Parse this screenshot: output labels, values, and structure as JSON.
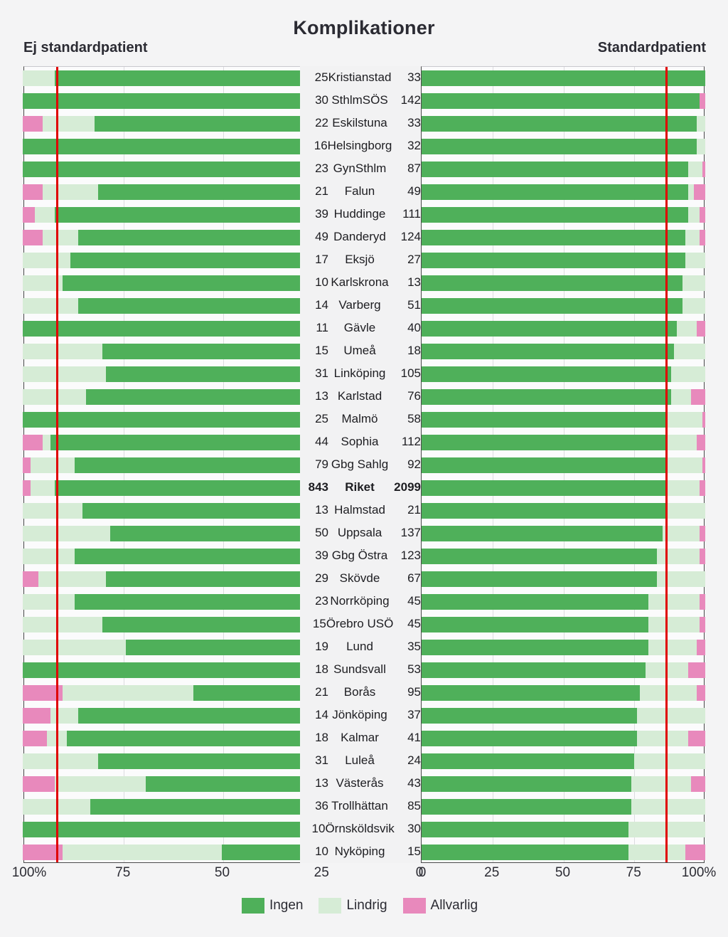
{
  "chart_data": {
    "type": "bar",
    "title": "Komplikationer",
    "subtype": "stacked-horizontal-bidirectional",
    "xlabel": "",
    "ylabel": "",
    "xlim": [
      0,
      100
    ],
    "grid": true,
    "legend_position": "bottom",
    "legend": [
      "Ingen",
      "Lindrig",
      "Allvarlig"
    ],
    "colors": {
      "ingen": "#4fb05a",
      "lindrig": "#d6ecd6",
      "allvarlig": "#e889bc",
      "reference_line": "#e00000",
      "background": "#f4f4f5"
    },
    "panels": [
      {
        "key": "left",
        "label": "Ej standardpatient",
        "reference_value": 92
      },
      {
        "key": "right",
        "label": "Standardpatient",
        "reference_value": 86
      }
    ],
    "axis_ticks_left": [
      "100%",
      "75",
      "50",
      "25",
      "0"
    ],
    "axis_ticks_right": [
      "0",
      "25",
      "50",
      "75",
      "100%"
    ],
    "tick_values_left": [
      100,
      75,
      50,
      25,
      0
    ],
    "tick_values_right": [
      0,
      25,
      50,
      75,
      100
    ],
    "series": [
      {
        "name": "Ingen",
        "key": "ingen"
      },
      {
        "name": "Lindrig",
        "key": "lindrig"
      },
      {
        "name": "Allvarlig",
        "key": "allvarlig"
      }
    ],
    "categories": [
      "Kristianstad",
      "SthlmSÖS",
      "Eskilstuna",
      "Helsingborg",
      "GynSthlm",
      "Falun",
      "Huddinge",
      "Danderyd",
      "Eksjö",
      "Karlskrona",
      "Varberg",
      "Gävle",
      "Umeå",
      "Linköping",
      "Karlstad",
      "Malmö",
      "Sophia",
      "Gbg Sahlg",
      "Riket",
      "Halmstad",
      "Uppsala",
      "Gbg Östra",
      "Skövde",
      "Norrköping",
      "Örebro USÖ",
      "Lund",
      "Sundsvall",
      "Borås",
      "Jönköping",
      "Kalmar",
      "Luleå",
      "Västerås",
      "Trollhättan",
      "Örnsköldsvik",
      "Nyköping"
    ],
    "rows": [
      {
        "name": "Kristianstad",
        "n_left": "25",
        "n_right": "33",
        "highlight": false,
        "left": {
          "ingen": 92,
          "lindrig": 8,
          "allvarlig": 0
        },
        "right": {
          "ingen": 100,
          "lindrig": 0,
          "allvarlig": 0
        }
      },
      {
        "name": "SthlmSÖS",
        "n_left": "30",
        "n_right": "142",
        "highlight": false,
        "left": {
          "ingen": 100,
          "lindrig": 0,
          "allvarlig": 0
        },
        "right": {
          "ingen": 98,
          "lindrig": 0,
          "allvarlig": 2
        }
      },
      {
        "name": "Eskilstuna",
        "n_left": "22",
        "n_right": "33",
        "highlight": false,
        "left": {
          "ingen": 82,
          "lindrig": 13,
          "allvarlig": 5
        },
        "right": {
          "ingen": 97,
          "lindrig": 3,
          "allvarlig": 0
        }
      },
      {
        "name": "Helsingborg",
        "n_left": "16",
        "n_right": "32",
        "highlight": false,
        "left": {
          "ingen": 100,
          "lindrig": 0,
          "allvarlig": 0
        },
        "right": {
          "ingen": 97,
          "lindrig": 3,
          "allvarlig": 0
        }
      },
      {
        "name": "GynSthlm",
        "n_left": "23",
        "n_right": "87",
        "highlight": false,
        "left": {
          "ingen": 100,
          "lindrig": 0,
          "allvarlig": 0
        },
        "right": {
          "ingen": 94,
          "lindrig": 5,
          "allvarlig": 1
        }
      },
      {
        "name": "Falun",
        "n_left": "21",
        "n_right": "49",
        "highlight": false,
        "left": {
          "ingen": 81,
          "lindrig": 14,
          "allvarlig": 5
        },
        "right": {
          "ingen": 94,
          "lindrig": 2,
          "allvarlig": 4
        }
      },
      {
        "name": "Huddinge",
        "n_left": "39",
        "n_right": "111",
        "highlight": false,
        "left": {
          "ingen": 92,
          "lindrig": 5,
          "allvarlig": 3
        },
        "right": {
          "ingen": 94,
          "lindrig": 4,
          "allvarlig": 2
        }
      },
      {
        "name": "Danderyd",
        "n_left": "49",
        "n_right": "124",
        "highlight": false,
        "left": {
          "ingen": 86,
          "lindrig": 9,
          "allvarlig": 5
        },
        "right": {
          "ingen": 93,
          "lindrig": 5,
          "allvarlig": 2
        }
      },
      {
        "name": "Eksjö",
        "n_left": "17",
        "n_right": "27",
        "highlight": false,
        "left": {
          "ingen": 88,
          "lindrig": 12,
          "allvarlig": 0
        },
        "right": {
          "ingen": 93,
          "lindrig": 7,
          "allvarlig": 0
        }
      },
      {
        "name": "Karlskrona",
        "n_left": "10",
        "n_right": "13",
        "highlight": false,
        "left": {
          "ingen": 90,
          "lindrig": 10,
          "allvarlig": 0
        },
        "right": {
          "ingen": 92,
          "lindrig": 8,
          "allvarlig": 0
        }
      },
      {
        "name": "Varberg",
        "n_left": "14",
        "n_right": "51",
        "highlight": false,
        "left": {
          "ingen": 86,
          "lindrig": 14,
          "allvarlig": 0
        },
        "right": {
          "ingen": 92,
          "lindrig": 8,
          "allvarlig": 0
        }
      },
      {
        "name": "Gävle",
        "n_left": "11",
        "n_right": "40",
        "highlight": false,
        "left": {
          "ingen": 100,
          "lindrig": 0,
          "allvarlig": 0
        },
        "right": {
          "ingen": 90,
          "lindrig": 7,
          "allvarlig": 3
        }
      },
      {
        "name": "Umeå",
        "n_left": "15",
        "n_right": "18",
        "highlight": false,
        "left": {
          "ingen": 80,
          "lindrig": 20,
          "allvarlig": 0
        },
        "right": {
          "ingen": 89,
          "lindrig": 11,
          "allvarlig": 0
        }
      },
      {
        "name": "Linköping",
        "n_left": "31",
        "n_right": "105",
        "highlight": false,
        "left": {
          "ingen": 79,
          "lindrig": 21,
          "allvarlig": 0
        },
        "right": {
          "ingen": 88,
          "lindrig": 12,
          "allvarlig": 0
        }
      },
      {
        "name": "Karlstad",
        "n_left": "13",
        "n_right": "76",
        "highlight": false,
        "left": {
          "ingen": 84,
          "lindrig": 16,
          "allvarlig": 0
        },
        "right": {
          "ingen": 88,
          "lindrig": 7,
          "allvarlig": 5
        }
      },
      {
        "name": "Malmö",
        "n_left": "25",
        "n_right": "58",
        "highlight": false,
        "left": {
          "ingen": 100,
          "lindrig": 0,
          "allvarlig": 0
        },
        "right": {
          "ingen": 86,
          "lindrig": 13,
          "allvarlig": 1
        }
      },
      {
        "name": "Sophia",
        "n_left": "44",
        "n_right": "112",
        "highlight": false,
        "left": {
          "ingen": 93,
          "lindrig": 2,
          "allvarlig": 5
        },
        "right": {
          "ingen": 86,
          "lindrig": 11,
          "allvarlig": 3
        }
      },
      {
        "name": "Gbg Sahlg",
        "n_left": "79",
        "n_right": "92",
        "highlight": false,
        "left": {
          "ingen": 87,
          "lindrig": 11,
          "allvarlig": 2
        },
        "right": {
          "ingen": 86,
          "lindrig": 13,
          "allvarlig": 1
        }
      },
      {
        "name": "Riket",
        "n_left": "843",
        "n_right": "2099",
        "highlight": true,
        "left": {
          "ingen": 92,
          "lindrig": 6,
          "allvarlig": 2
        },
        "right": {
          "ingen": 86,
          "lindrig": 12,
          "allvarlig": 2
        }
      },
      {
        "name": "Halmstad",
        "n_left": "13",
        "n_right": "21",
        "highlight": false,
        "left": {
          "ingen": 85,
          "lindrig": 15,
          "allvarlig": 0
        },
        "right": {
          "ingen": 86,
          "lindrig": 14,
          "allvarlig": 0
        }
      },
      {
        "name": "Uppsala",
        "n_left": "50",
        "n_right": "137",
        "highlight": false,
        "left": {
          "ingen": 78,
          "lindrig": 22,
          "allvarlig": 0
        },
        "right": {
          "ingen": 85,
          "lindrig": 13,
          "allvarlig": 2
        }
      },
      {
        "name": "Gbg Östra",
        "n_left": "39",
        "n_right": "123",
        "highlight": false,
        "left": {
          "ingen": 87,
          "lindrig": 13,
          "allvarlig": 0
        },
        "right": {
          "ingen": 83,
          "lindrig": 15,
          "allvarlig": 2
        }
      },
      {
        "name": "Skövde",
        "n_left": "29",
        "n_right": "67",
        "highlight": false,
        "left": {
          "ingen": 79,
          "lindrig": 17,
          "allvarlig": 4
        },
        "right": {
          "ingen": 83,
          "lindrig": 17,
          "allvarlig": 0
        }
      },
      {
        "name": "Norrköping",
        "n_left": "23",
        "n_right": "45",
        "highlight": false,
        "left": {
          "ingen": 87,
          "lindrig": 13,
          "allvarlig": 0
        },
        "right": {
          "ingen": 80,
          "lindrig": 18,
          "allvarlig": 2
        }
      },
      {
        "name": "Örebro USÖ",
        "n_left": "15",
        "n_right": "45",
        "highlight": false,
        "left": {
          "ingen": 80,
          "lindrig": 20,
          "allvarlig": 0
        },
        "right": {
          "ingen": 80,
          "lindrig": 18,
          "allvarlig": 2
        }
      },
      {
        "name": "Lund",
        "n_left": "19",
        "n_right": "35",
        "highlight": false,
        "left": {
          "ingen": 74,
          "lindrig": 26,
          "allvarlig": 0
        },
        "right": {
          "ingen": 80,
          "lindrig": 17,
          "allvarlig": 3
        }
      },
      {
        "name": "Sundsvall",
        "n_left": "18",
        "n_right": "53",
        "highlight": false,
        "left": {
          "ingen": 100,
          "lindrig": 0,
          "allvarlig": 0
        },
        "right": {
          "ingen": 79,
          "lindrig": 15,
          "allvarlig": 6
        }
      },
      {
        "name": "Borås",
        "n_left": "21",
        "n_right": "95",
        "highlight": false,
        "left": {
          "ingen": 57,
          "lindrig": 33,
          "allvarlig": 10
        },
        "right": {
          "ingen": 77,
          "lindrig": 20,
          "allvarlig": 3
        }
      },
      {
        "name": "Jönköping",
        "n_left": "14",
        "n_right": "37",
        "highlight": false,
        "left": {
          "ingen": 86,
          "lindrig": 7,
          "allvarlig": 7
        },
        "right": {
          "ingen": 76,
          "lindrig": 24,
          "allvarlig": 0
        }
      },
      {
        "name": "Kalmar",
        "n_left": "18",
        "n_right": "41",
        "highlight": false,
        "left": {
          "ingen": 89,
          "lindrig": 5,
          "allvarlig": 6
        },
        "right": {
          "ingen": 76,
          "lindrig": 18,
          "allvarlig": 6
        }
      },
      {
        "name": "Luleå",
        "n_left": "31",
        "n_right": "24",
        "highlight": false,
        "left": {
          "ingen": 81,
          "lindrig": 19,
          "allvarlig": 0
        },
        "right": {
          "ingen": 75,
          "lindrig": 25,
          "allvarlig": 0
        }
      },
      {
        "name": "Västerås",
        "n_left": "13",
        "n_right": "43",
        "highlight": false,
        "left": {
          "ingen": 69,
          "lindrig": 23,
          "allvarlig": 8
        },
        "right": {
          "ingen": 74,
          "lindrig": 21,
          "allvarlig": 5
        }
      },
      {
        "name": "Trollhättan",
        "n_left": "36",
        "n_right": "85",
        "highlight": false,
        "left": {
          "ingen": 83,
          "lindrig": 17,
          "allvarlig": 0
        },
        "right": {
          "ingen": 74,
          "lindrig": 26,
          "allvarlig": 0
        }
      },
      {
        "name": "Örnsköldsvik",
        "n_left": "10",
        "n_right": "30",
        "highlight": false,
        "left": {
          "ingen": 100,
          "lindrig": 0,
          "allvarlig": 0
        },
        "right": {
          "ingen": 73,
          "lindrig": 27,
          "allvarlig": 0
        }
      },
      {
        "name": "Nyköping",
        "n_left": "10",
        "n_right": "15",
        "highlight": false,
        "left": {
          "ingen": 50,
          "lindrig": 40,
          "allvarlig": 10
        },
        "right": {
          "ingen": 73,
          "lindrig": 20,
          "allvarlig": 7
        }
      }
    ]
  }
}
